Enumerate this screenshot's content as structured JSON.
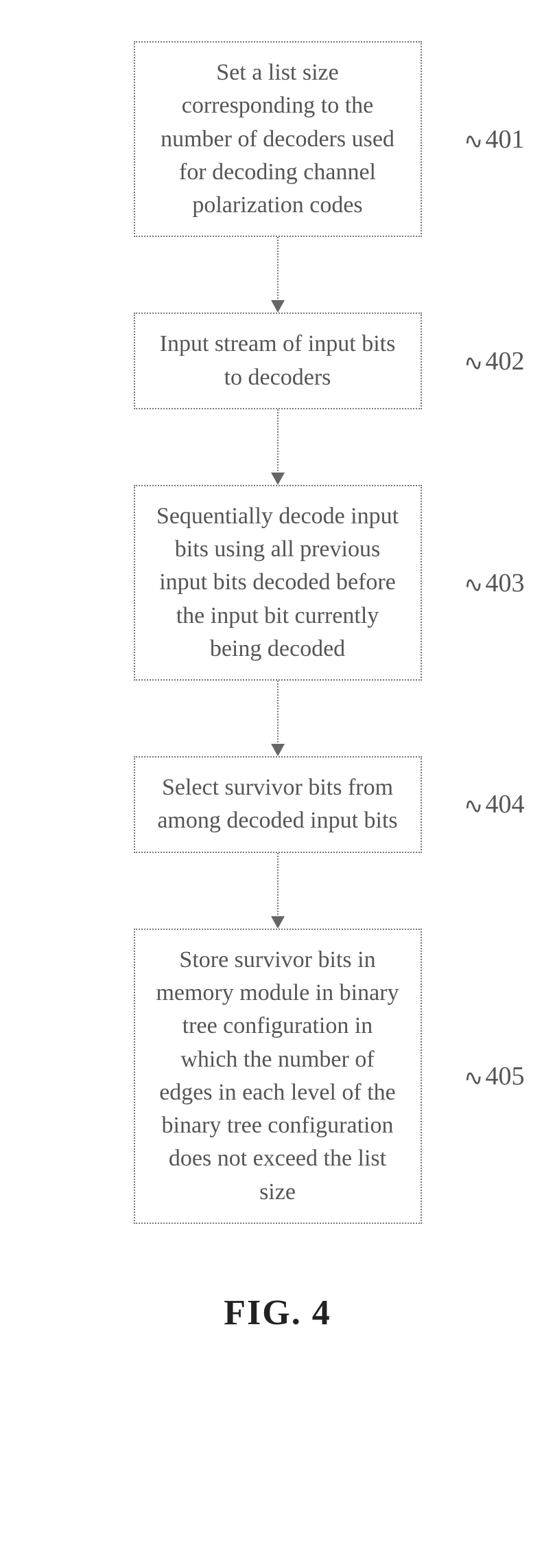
{
  "chart_data": {
    "type": "flowchart",
    "title": "FIG. 4",
    "nodes": [
      {
        "id": "401",
        "text": "Set a list size corresponding to the number of decoders used for decoding channel polarization codes"
      },
      {
        "id": "402",
        "text": "Input stream of input bits to decoders"
      },
      {
        "id": "403",
        "text": "Sequentially decode input bits using all previous input bits decoded before the input bit currently being decoded"
      },
      {
        "id": "404",
        "text": "Select survivor bits from among decoded input bits"
      },
      {
        "id": "405",
        "text": "Store survivor bits in memory module in binary tree configuration in which the number of edges in each level of the binary tree configuration does not exceed the list size"
      }
    ],
    "edges": [
      {
        "from": "401",
        "to": "402"
      },
      {
        "from": "402",
        "to": "403"
      },
      {
        "from": "403",
        "to": "404"
      },
      {
        "from": "404",
        "to": "405"
      }
    ]
  }
}
